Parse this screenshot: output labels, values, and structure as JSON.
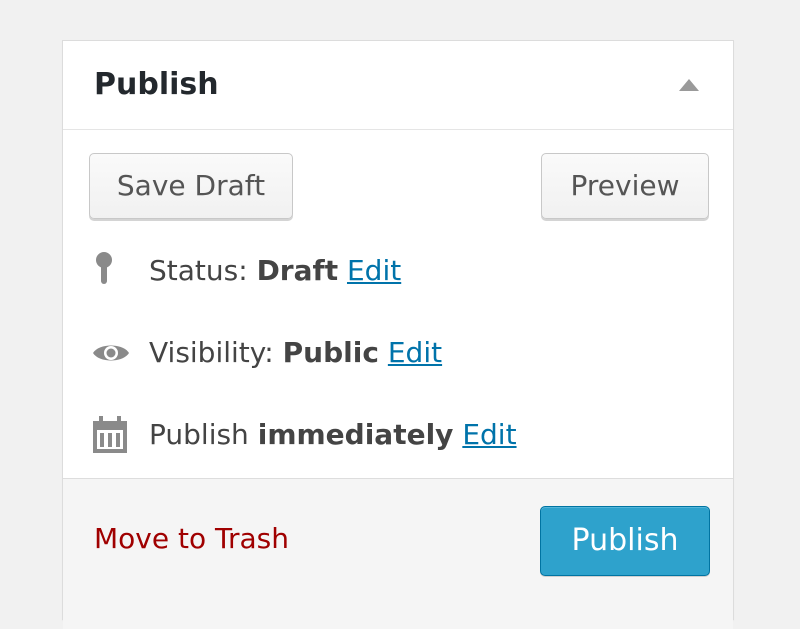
{
  "panel": {
    "title": "Publish",
    "toggle_icon": "collapse-arrow-up-icon"
  },
  "actions": {
    "save_draft_label": "Save Draft",
    "preview_label": "Preview"
  },
  "status": {
    "icon": "pin-icon",
    "label": "Status:",
    "value": "Draft",
    "edit_label": "Edit"
  },
  "visibility": {
    "icon": "eye-icon",
    "label": "Visibility:",
    "value": "Public",
    "edit_label": "Edit"
  },
  "schedule": {
    "icon": "calendar-icon",
    "label": "Publish",
    "value": "immediately",
    "edit_label": "Edit"
  },
  "footer": {
    "trash_label": "Move to Trash",
    "publish_label": "Publish"
  },
  "colors": {
    "link": "#0073aa",
    "trash": "#a00000",
    "primary_button": "#2ea2cc",
    "icon_gray": "#8a8a8a"
  }
}
